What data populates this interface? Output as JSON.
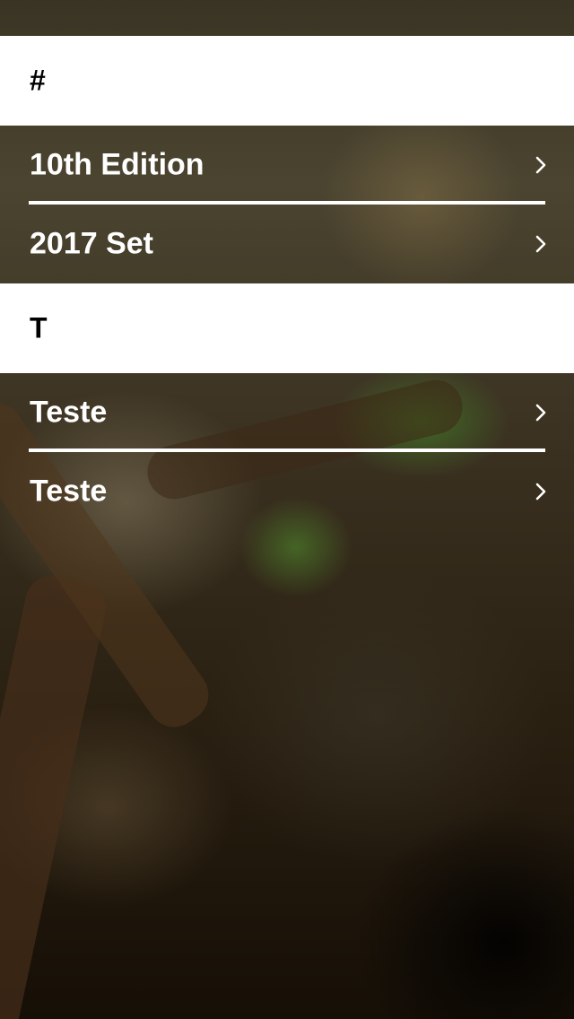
{
  "sections": [
    {
      "header": "#",
      "rows": [
        {
          "label": "10th Edition"
        },
        {
          "label": "2017 Set"
        }
      ]
    },
    {
      "header": "T",
      "rows": [
        {
          "label": "Teste"
        },
        {
          "label": "Teste"
        }
      ]
    }
  ],
  "colors": {
    "section_header_bg": "#ffffff",
    "row_text": "#ffffff",
    "header_text": "#000000"
  },
  "icons": {
    "row_accessory": "chevron-right-icon"
  }
}
